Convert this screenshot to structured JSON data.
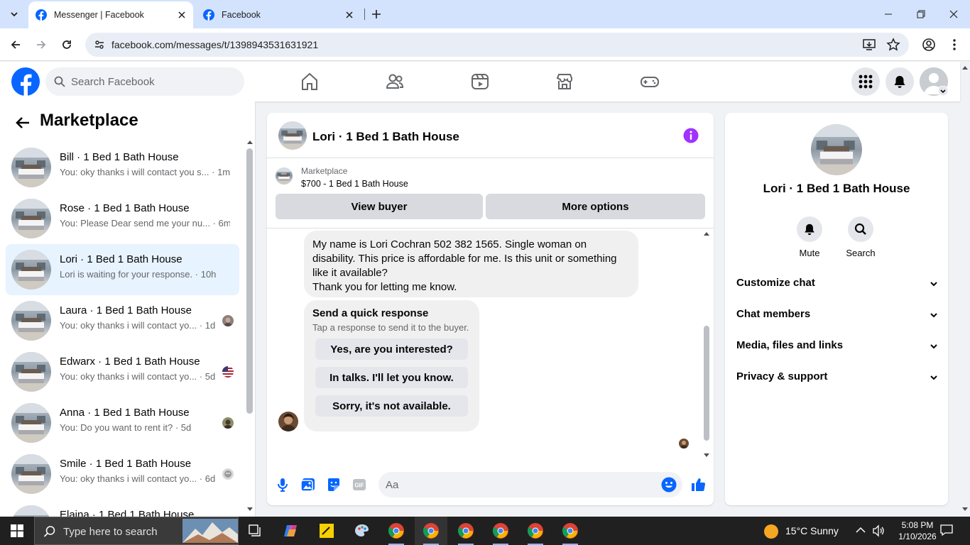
{
  "browser": {
    "tabs": [
      {
        "title": "Messenger | Facebook",
        "active": true
      },
      {
        "title": "Facebook",
        "active": false
      }
    ],
    "url": "facebook.com/messages/t/1398943531631921"
  },
  "header": {
    "search_placeholder": "Search Facebook",
    "nav_icons": [
      "home-icon",
      "friends-icon",
      "video-icon",
      "marketplace-icon",
      "gaming-icon"
    ],
    "brand_color": "#0866ff"
  },
  "left": {
    "title": "Marketplace",
    "conversations": [
      {
        "name": "Bill · 1 Bed 1 Bath House",
        "preview": "You: oky thanks i will contact you s...",
        "time": "· 1m",
        "selected": false
      },
      {
        "name": "Rose · 1 Bed 1 Bath House",
        "preview": "You: Please Dear send me your nu...",
        "time": "· 6m",
        "selected": false
      },
      {
        "name": "Lori · 1 Bed 1 Bath House",
        "preview": "Lori is waiting for your response.",
        "time": "· 10h",
        "selected": true
      },
      {
        "name": "Laura · 1 Bed 1 Bath House",
        "preview": "You: oky thanks i will contact yo...",
        "time": "· 1d",
        "selected": false
      },
      {
        "name": "Edwarx · 1 Bed 1 Bath House",
        "preview": "You: oky thanks i will contact yo...",
        "time": "· 5d",
        "selected": false
      },
      {
        "name": "Anna · 1 Bed 1 Bath House",
        "preview": "You: Do you want to rent it?",
        "time": "· 5d",
        "selected": false
      },
      {
        "name": "Smile · 1 Bed 1 Bath House",
        "preview": "You: oky thanks i will contact yo...",
        "time": "· 6d",
        "selected": false
      },
      {
        "name": "Elaina · 1 Bed 1 Bath House",
        "preview": "",
        "time": "",
        "selected": false
      }
    ]
  },
  "chat": {
    "title": "Lori · 1 Bed 1 Bath House",
    "marketplace_label": "Marketplace",
    "listing": "$700 - 1 Bed 1 Bath House",
    "view_buyer": "View buyer",
    "more_options": "More options",
    "message_lines": [
      "My name is Lori Cochran 502 382 1565.  Single woman on",
      "disability.  This price is affordable for me.  Is this unit or something",
      "like it available?",
      "Thank you for letting me know."
    ],
    "quick_title": "Send a quick response",
    "quick_sub": "Tap a response to send it to the buyer.",
    "quick_replies": [
      "Yes, are you interested?",
      "In talks. I'll let you know.",
      "Sorry, it's not available."
    ],
    "input_placeholder": "Aa",
    "accent_color": "#0866ff",
    "info_color": "#a033ff"
  },
  "right": {
    "name": "Lori · 1 Bed 1 Bath House",
    "actions": [
      "Mute",
      "Search"
    ],
    "sections": [
      "Customize chat",
      "Chat members",
      "Media, files and links",
      "Privacy & support"
    ]
  },
  "taskbar": {
    "search_placeholder": "Type here to search",
    "weather": "15°C  Sunny",
    "time": "5:08 PM",
    "date": "1/10/2026"
  }
}
